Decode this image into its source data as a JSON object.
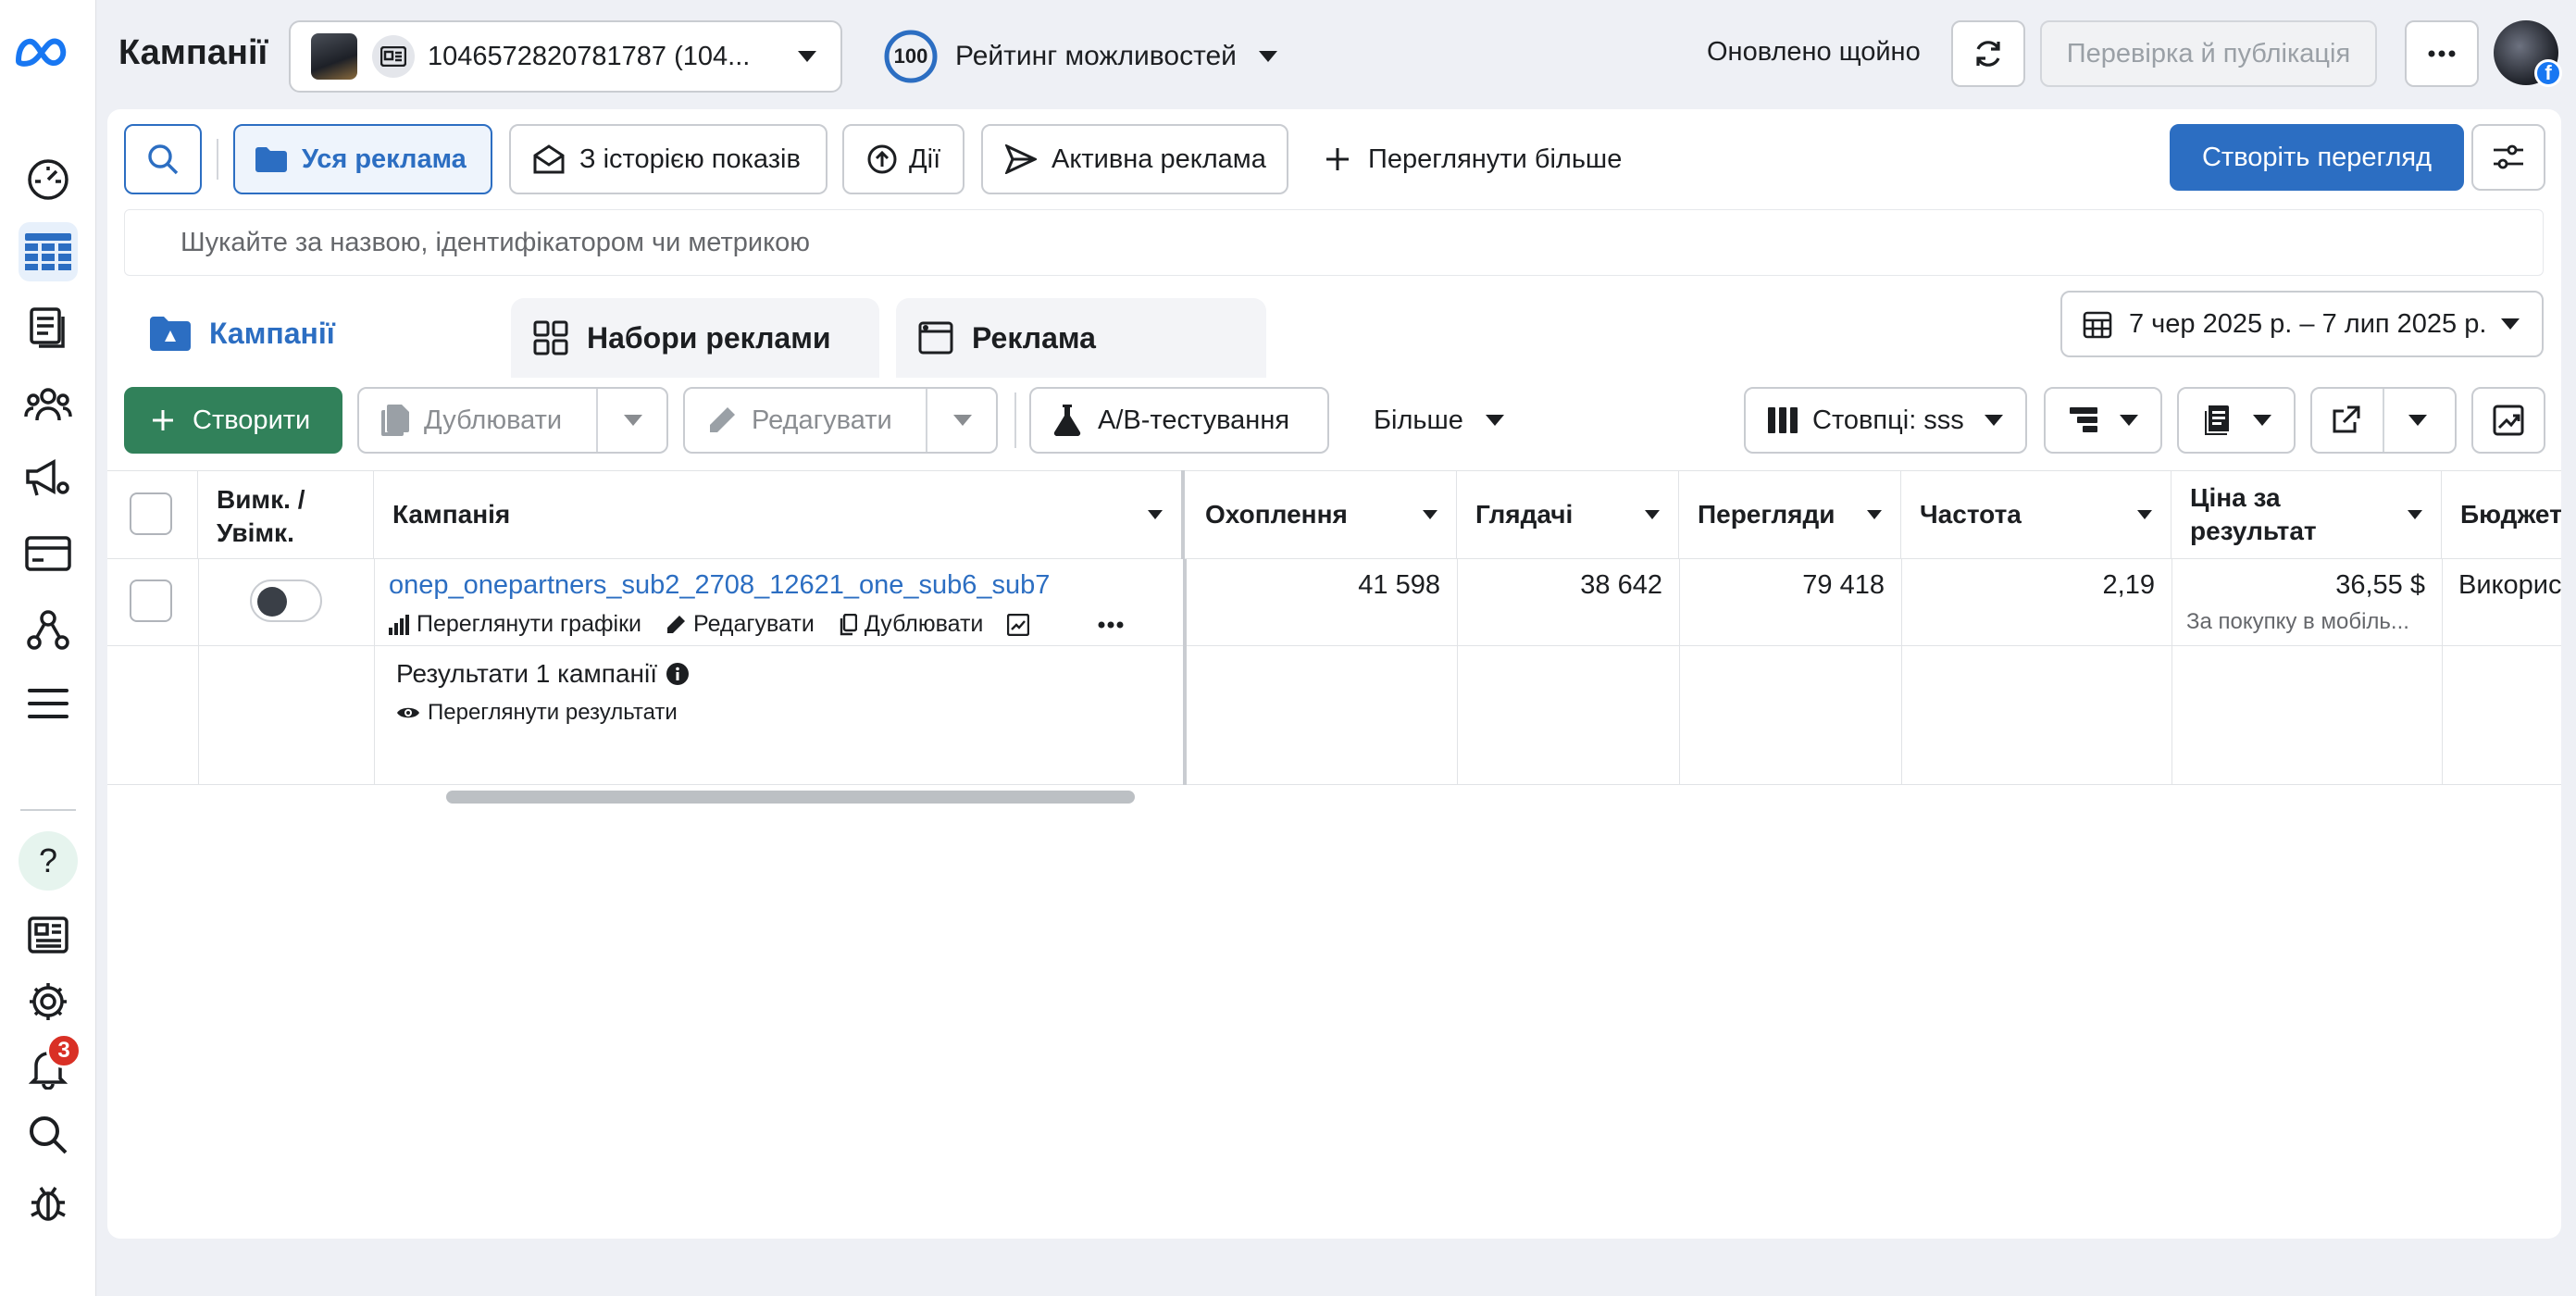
{
  "header": {
    "title": "Кампанії",
    "account_id": "1046572820781787 (104...",
    "opportunity_score": "100",
    "opportunity_label": "Рейтинг можливостей",
    "updated_label": "Оновлено щойно",
    "review_publish_label": "Перевірка й публікація"
  },
  "filters": {
    "all_ads": "Уся реклама",
    "with_delivery": "З історією показів",
    "actions": "Дії",
    "active_ads": "Активна реклама",
    "see_more": "Переглянути більше",
    "create_view": "Створіть перегляд"
  },
  "search": {
    "placeholder": "Шукайте за назвою, ідентифікатором чи метрикою"
  },
  "tabs": {
    "campaigns": "Кампанії",
    "ad_sets": "Набори реклами",
    "ads": "Реклама"
  },
  "date_range": "7 чер 2025 р. – 7 лип 2025 р.",
  "toolbar": {
    "create": "Створити",
    "duplicate": "Дублювати",
    "edit": "Редагувати",
    "ab_test": "A/B-тестування",
    "more": "Більше",
    "columns": "Стовпці: sss"
  },
  "table": {
    "headers": {
      "toggle": [
        "Вимк. /",
        "Увімк."
      ],
      "campaign": "Кампанія",
      "reach": "Охоплення",
      "viewers": "Глядачі",
      "views": "Перегляди",
      "frequency": "Частота",
      "cost_per_result": [
        "Ціна за",
        "результат"
      ],
      "budget": "Бюджет"
    },
    "row": {
      "name": "onep_onepartners_sub2_2708_12621_one_sub6_sub7",
      "view_charts": "Переглянути графіки",
      "edit": "Редагувати",
      "duplicate": "Дублювати",
      "reach": "41 598",
      "viewers": "38 642",
      "views": "79 418",
      "frequency": "2,19",
      "cost_per_result": "36,55 $",
      "cost_per_result_note": "За покупку в мобіль...",
      "budget": "Викорис"
    },
    "summary": {
      "label": "Результати 1 кампанії",
      "view_results": "Переглянути результати"
    }
  },
  "notifications_count": "3"
}
